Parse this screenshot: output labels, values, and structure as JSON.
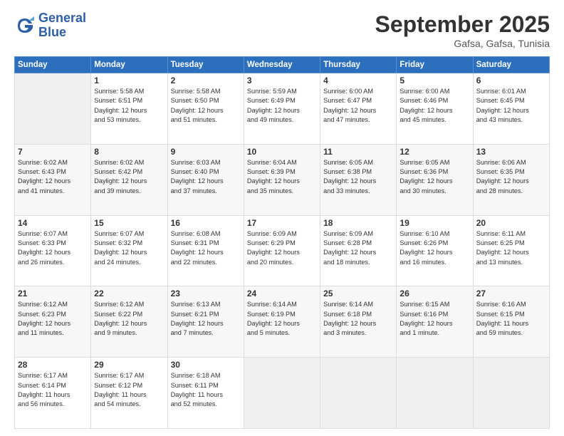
{
  "logo": {
    "line1": "General",
    "line2": "Blue"
  },
  "header": {
    "month": "September 2025",
    "location": "Gafsa, Gafsa, Tunisia"
  },
  "weekdays": [
    "Sunday",
    "Monday",
    "Tuesday",
    "Wednesday",
    "Thursday",
    "Friday",
    "Saturday"
  ],
  "weeks": [
    [
      {
        "day": "",
        "info": ""
      },
      {
        "day": "1",
        "info": "Sunrise: 5:58 AM\nSunset: 6:51 PM\nDaylight: 12 hours\nand 53 minutes."
      },
      {
        "day": "2",
        "info": "Sunrise: 5:58 AM\nSunset: 6:50 PM\nDaylight: 12 hours\nand 51 minutes."
      },
      {
        "day": "3",
        "info": "Sunrise: 5:59 AM\nSunset: 6:49 PM\nDaylight: 12 hours\nand 49 minutes."
      },
      {
        "day": "4",
        "info": "Sunrise: 6:00 AM\nSunset: 6:47 PM\nDaylight: 12 hours\nand 47 minutes."
      },
      {
        "day": "5",
        "info": "Sunrise: 6:00 AM\nSunset: 6:46 PM\nDaylight: 12 hours\nand 45 minutes."
      },
      {
        "day": "6",
        "info": "Sunrise: 6:01 AM\nSunset: 6:45 PM\nDaylight: 12 hours\nand 43 minutes."
      }
    ],
    [
      {
        "day": "7",
        "info": "Sunrise: 6:02 AM\nSunset: 6:43 PM\nDaylight: 12 hours\nand 41 minutes."
      },
      {
        "day": "8",
        "info": "Sunrise: 6:02 AM\nSunset: 6:42 PM\nDaylight: 12 hours\nand 39 minutes."
      },
      {
        "day": "9",
        "info": "Sunrise: 6:03 AM\nSunset: 6:40 PM\nDaylight: 12 hours\nand 37 minutes."
      },
      {
        "day": "10",
        "info": "Sunrise: 6:04 AM\nSunset: 6:39 PM\nDaylight: 12 hours\nand 35 minutes."
      },
      {
        "day": "11",
        "info": "Sunrise: 6:05 AM\nSunset: 6:38 PM\nDaylight: 12 hours\nand 33 minutes."
      },
      {
        "day": "12",
        "info": "Sunrise: 6:05 AM\nSunset: 6:36 PM\nDaylight: 12 hours\nand 30 minutes."
      },
      {
        "day": "13",
        "info": "Sunrise: 6:06 AM\nSunset: 6:35 PM\nDaylight: 12 hours\nand 28 minutes."
      }
    ],
    [
      {
        "day": "14",
        "info": "Sunrise: 6:07 AM\nSunset: 6:33 PM\nDaylight: 12 hours\nand 26 minutes."
      },
      {
        "day": "15",
        "info": "Sunrise: 6:07 AM\nSunset: 6:32 PM\nDaylight: 12 hours\nand 24 minutes."
      },
      {
        "day": "16",
        "info": "Sunrise: 6:08 AM\nSunset: 6:31 PM\nDaylight: 12 hours\nand 22 minutes."
      },
      {
        "day": "17",
        "info": "Sunrise: 6:09 AM\nSunset: 6:29 PM\nDaylight: 12 hours\nand 20 minutes."
      },
      {
        "day": "18",
        "info": "Sunrise: 6:09 AM\nSunset: 6:28 PM\nDaylight: 12 hours\nand 18 minutes."
      },
      {
        "day": "19",
        "info": "Sunrise: 6:10 AM\nSunset: 6:26 PM\nDaylight: 12 hours\nand 16 minutes."
      },
      {
        "day": "20",
        "info": "Sunrise: 6:11 AM\nSunset: 6:25 PM\nDaylight: 12 hours\nand 13 minutes."
      }
    ],
    [
      {
        "day": "21",
        "info": "Sunrise: 6:12 AM\nSunset: 6:23 PM\nDaylight: 12 hours\nand 11 minutes."
      },
      {
        "day": "22",
        "info": "Sunrise: 6:12 AM\nSunset: 6:22 PM\nDaylight: 12 hours\nand 9 minutes."
      },
      {
        "day": "23",
        "info": "Sunrise: 6:13 AM\nSunset: 6:21 PM\nDaylight: 12 hours\nand 7 minutes."
      },
      {
        "day": "24",
        "info": "Sunrise: 6:14 AM\nSunset: 6:19 PM\nDaylight: 12 hours\nand 5 minutes."
      },
      {
        "day": "25",
        "info": "Sunrise: 6:14 AM\nSunset: 6:18 PM\nDaylight: 12 hours\nand 3 minutes."
      },
      {
        "day": "26",
        "info": "Sunrise: 6:15 AM\nSunset: 6:16 PM\nDaylight: 12 hours\nand 1 minute."
      },
      {
        "day": "27",
        "info": "Sunrise: 6:16 AM\nSunset: 6:15 PM\nDaylight: 11 hours\nand 59 minutes."
      }
    ],
    [
      {
        "day": "28",
        "info": "Sunrise: 6:17 AM\nSunset: 6:14 PM\nDaylight: 11 hours\nand 56 minutes."
      },
      {
        "day": "29",
        "info": "Sunrise: 6:17 AM\nSunset: 6:12 PM\nDaylight: 11 hours\nand 54 minutes."
      },
      {
        "day": "30",
        "info": "Sunrise: 6:18 AM\nSunset: 6:11 PM\nDaylight: 11 hours\nand 52 minutes."
      },
      {
        "day": "",
        "info": ""
      },
      {
        "day": "",
        "info": ""
      },
      {
        "day": "",
        "info": ""
      },
      {
        "day": "",
        "info": ""
      }
    ]
  ]
}
